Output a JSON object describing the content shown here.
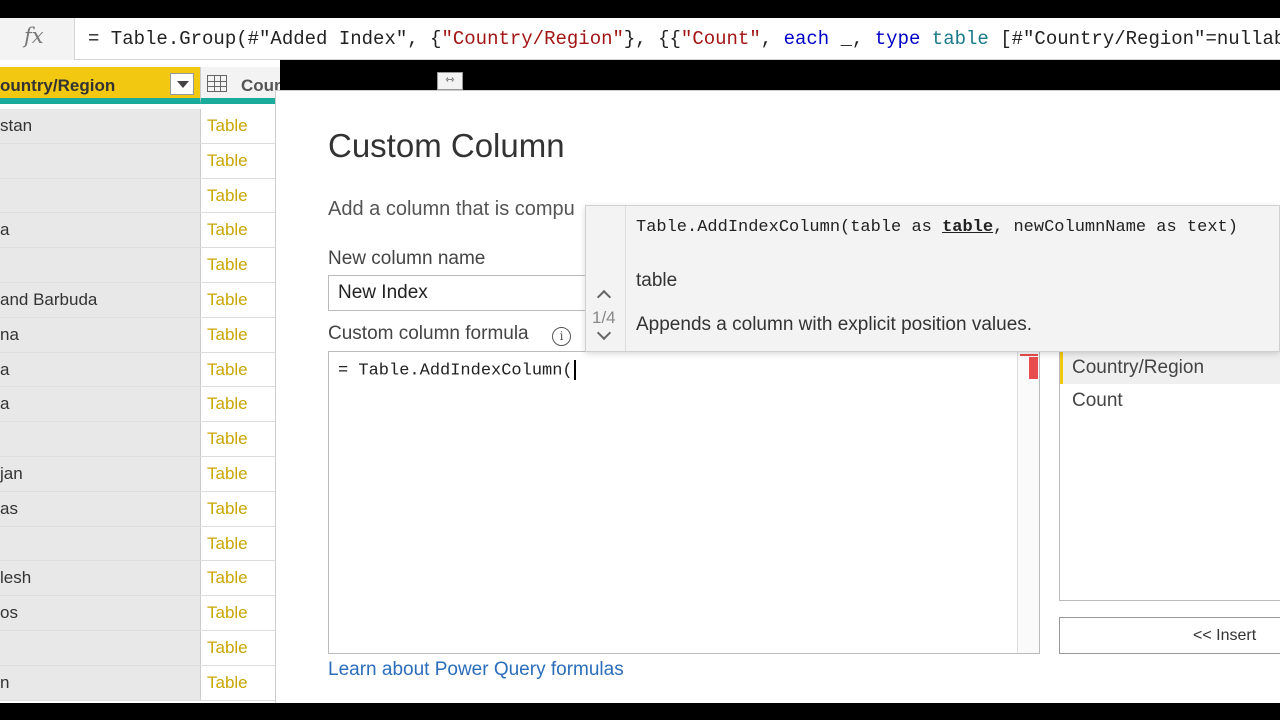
{
  "formula_bar": {
    "fx_label": "fx",
    "parts": {
      "p1": "= Table.Group(#\"Added Index\", {",
      "s1": "\"Country/Region\"",
      "p2": "}, {{",
      "s2": "\"Count\"",
      "p3": ", ",
      "k1": "each",
      "p4": " _, ",
      "k2": "type",
      "p5": " ",
      "t1": "table",
      "p6": " [#\"Country/Region\"=nullable"
    }
  },
  "grid": {
    "country_header": "ountry/Region",
    "count_header": "Count",
    "rows": [
      {
        "country": "stan",
        "count": "Table"
      },
      {
        "country": "",
        "count": "Table"
      },
      {
        "country": "",
        "count": "Table"
      },
      {
        "country": "a",
        "count": "Table"
      },
      {
        "country": "",
        "count": "Table"
      },
      {
        "country": " and Barbuda",
        "count": "Table"
      },
      {
        "country": "na",
        "count": "Table"
      },
      {
        "country": "a",
        "count": "Table"
      },
      {
        "country": "a",
        "count": "Table"
      },
      {
        "country": "",
        "count": "Table"
      },
      {
        "country": "jan",
        "count": "Table"
      },
      {
        "country": "as",
        "count": "Table"
      },
      {
        "country": "",
        "count": "Table"
      },
      {
        "country": "lesh",
        "count": "Table"
      },
      {
        "country": "os",
        "count": "Table"
      },
      {
        "country": "",
        "count": "Table"
      },
      {
        "country": "n",
        "count": "Table"
      }
    ]
  },
  "dialog": {
    "title": "Custom Column",
    "subtitle": "Add a column that is compu",
    "new_column_label": "New column name",
    "new_column_value": "New Index",
    "formula_label": "Custom column formula",
    "info_glyph": "i",
    "formula_value": "= Table.AddIndexColumn(",
    "learn_link": "Learn about Power Query formulas",
    "available_columns": [
      "Country/Region",
      "Count"
    ],
    "insert_button": "<< Insert"
  },
  "intellisense": {
    "sig_prefix": "Table.AddIndexColumn(table as ",
    "sig_bold": "table",
    "sig_suffix": ", newColumnName as text)",
    "position": "1/4",
    "param_name": "table",
    "description": "Appends a column with explicit position values."
  },
  "colors": {
    "accent_yellow": "#f2c811",
    "header_underline": "#1aab9b",
    "link_blue": "#2a6ebb",
    "error_red": "#e84c4c"
  }
}
